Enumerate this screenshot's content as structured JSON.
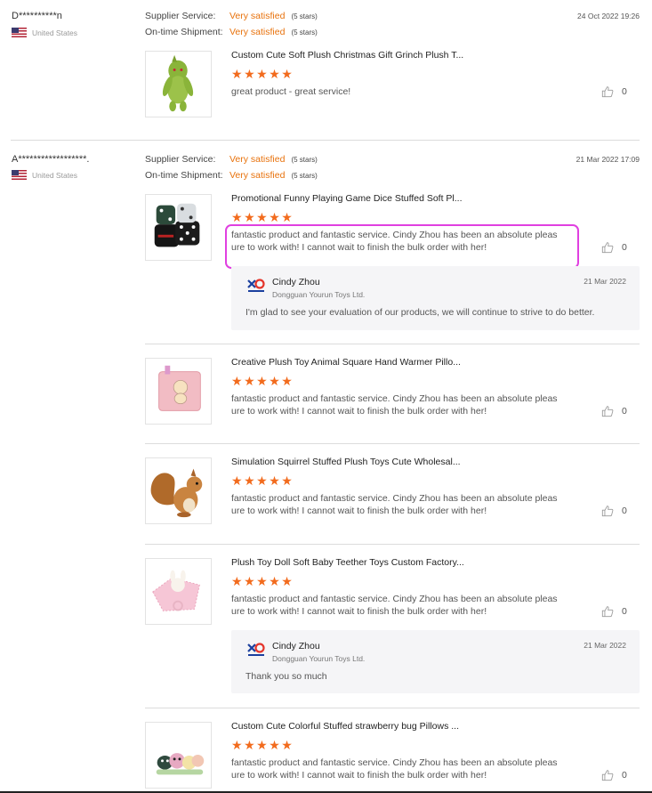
{
  "reviews": [
    {
      "buyer": "D**********n",
      "country": "United States",
      "date": "24 Oct 2022 19:26",
      "supplier_label": "Supplier Service:",
      "supplier_value": "Very satisfied",
      "supplier_stars": "(5 stars)",
      "shipment_label": "On-time Shipment:",
      "shipment_value": "Very satisfied",
      "shipment_stars": "(5 stars)",
      "items": [
        {
          "title": "Custom Cute Soft Plush Christmas Gift Grinch Plush T...",
          "rating": 5,
          "text": "great product - great service!",
          "likes": "0"
        }
      ]
    },
    {
      "buyer": "A******************.",
      "country": "United States",
      "date": "21 Mar 2022 17:09",
      "supplier_label": "Supplier Service:",
      "supplier_value": "Very satisfied",
      "supplier_stars": "(5 stars)",
      "shipment_label": "On-time Shipment:",
      "shipment_value": "Very satisfied",
      "shipment_stars": "(5 stars)",
      "items": [
        {
          "title": "Promotional Funny Playing Game Dice Stuffed Soft Pl...",
          "rating": 5,
          "text": "fantastic product and fantastic service. Cindy Zhou has been an absolute pleasure to work with! I cannot wait to finish the bulk order with her!",
          "likes": "0",
          "reply": {
            "name": "Cindy Zhou",
            "company": "Dongguan Yourun Toys Ltd.",
            "date": "21 Mar 2022",
            "text": "I'm glad to see your evaluation of our products, we will continue to strive to do better."
          }
        },
        {
          "title": "Creative Plush Toy Animal Square Hand Warmer Pillo...",
          "rating": 5,
          "text": "fantastic product and fantastic service. Cindy Zhou has been an absolute pleasure to work with! I cannot wait to finish the bulk order with her!",
          "likes": "0"
        },
        {
          "title": "Simulation Squirrel Stuffed Plush Toys Cute Wholesal...",
          "rating": 5,
          "text": "fantastic product and fantastic service. Cindy Zhou has been an absolute pleasure to work with! I cannot wait to finish the bulk order with her!",
          "likes": "0"
        },
        {
          "title": "Plush Toy Doll Soft Baby Teether Toys Custom Factory...",
          "rating": 5,
          "text": "fantastic product and fantastic service. Cindy Zhou has been an absolute pleasure to work with! I cannot wait to finish the bulk order with her!",
          "likes": "0",
          "reply": {
            "name": "Cindy Zhou",
            "company": "Dongguan Yourun Toys Ltd.",
            "date": "21 Mar 2022",
            "text": "Thank you so much"
          }
        },
        {
          "title": "Custom Cute Colorful Stuffed strawberry bug Pillows ...",
          "rating": 5,
          "text": "fantastic product and fantastic service. Cindy Zhou has been an absolute pleasure to work with! I cannot wait to finish the bulk order with her!",
          "likes": "0"
        }
      ]
    }
  ],
  "colors": {
    "accent": "#e8720c",
    "star": "#f26b1d",
    "highlight": "#e040e0",
    "reply_bg": "#f5f5f7"
  },
  "icons": {
    "like": "thumbs-up-icon",
    "flag": "us-flag-icon",
    "logo": "yourun-logo-icon",
    "star": "star-icon"
  }
}
